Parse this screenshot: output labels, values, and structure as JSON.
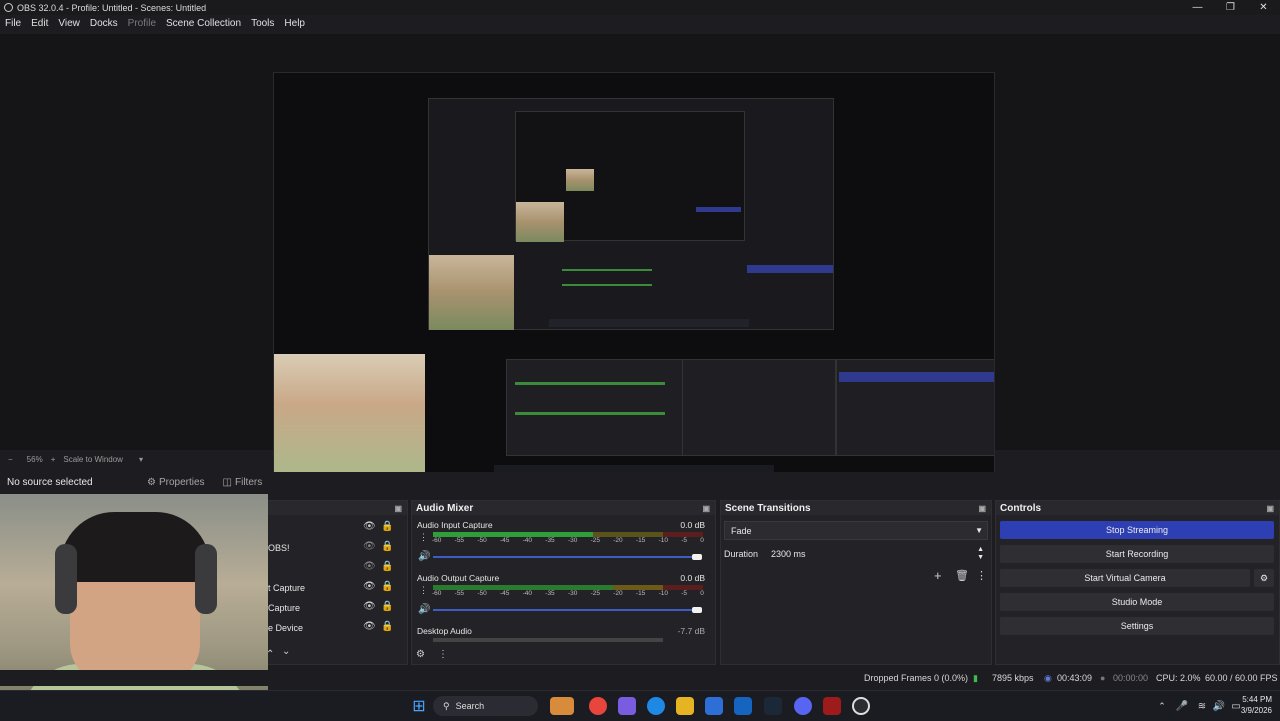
{
  "window": {
    "title": "OBS 32.0.4 - Profile: Untitled - Scenes: Untitled",
    "minimize": "—",
    "restore": "❐",
    "close": "✕"
  },
  "menu": [
    "File",
    "Edit",
    "View",
    "Docks",
    "Profile",
    "Scene Collection",
    "Tools",
    "Help"
  ],
  "zoom": {
    "minus": "−",
    "value": "56%",
    "plus": "+",
    "mode": "Scale to Window",
    "arrow": "▾"
  },
  "source_bar": {
    "no_source": "No source selected",
    "properties": "Properties",
    "filters": "Filters"
  },
  "sources": {
    "items": [
      "OBS!",
      "t Capture",
      "Capture",
      "e Device"
    ]
  },
  "audio_mixer": {
    "title": "Audio Mixer",
    "channels": [
      {
        "name": "Audio Input Capture",
        "db": "0.0 dB"
      },
      {
        "name": "Audio Output Capture",
        "db": "0.0 dB"
      },
      {
        "name": "Desktop Audio",
        "db": "-7.7 dB"
      }
    ],
    "ticks": [
      "-60",
      "-55",
      "-50",
      "-45",
      "-40",
      "-35",
      "-30",
      "-25",
      "-20",
      "-15",
      "-10",
      "-5",
      "0"
    ]
  },
  "scene_transitions": {
    "title": "Scene Transitions",
    "transition": "Fade",
    "duration_label": "Duration",
    "duration_value": "2300 ms"
  },
  "controls": {
    "title": "Controls",
    "stop_streaming": "Stop Streaming",
    "start_recording": "Start Recording",
    "start_virtual_camera": "Start Virtual Camera",
    "studio_mode": "Studio Mode",
    "settings": "Settings"
  },
  "status": {
    "dropped_frames": "Dropped Frames 0 (0.0%)",
    "bitrate": "7895 kbps",
    "stream_time": "00:43:09",
    "record_time": "00:00:00",
    "cpu": "CPU: 2.0%",
    "fps": "60.00 / 60.00 FPS"
  },
  "taskbar": {
    "search": "Search",
    "time": "5:44 PM",
    "date": "3/9/2026"
  },
  "colors": {
    "accent": "#2e3fb3",
    "meter_green": "#2f9e38",
    "meter_yellow": "#b4a21f",
    "meter_red": "#b22a2a"
  }
}
